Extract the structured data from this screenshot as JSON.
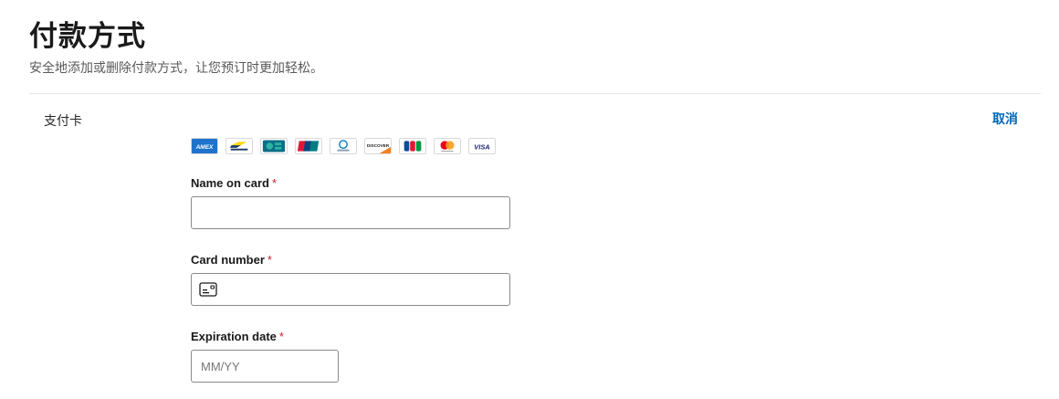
{
  "header": {
    "title": "付款方式",
    "subtitle": "安全地添加或删除付款方式，让您预订时更加轻松。"
  },
  "section": {
    "label": "支付卡",
    "cancel_label": "取消"
  },
  "card_brands": [
    {
      "name": "amex-icon",
      "label": "AMEX"
    },
    {
      "name": "bancontact-icon",
      "label": "Bancontact"
    },
    {
      "name": "cartes-bancaires-icon",
      "label": "CB"
    },
    {
      "name": "unionpay-icon",
      "label": "UnionPay"
    },
    {
      "name": "diners-club-icon",
      "label": "Diners Club"
    },
    {
      "name": "discover-icon",
      "label": "DISCOVER"
    },
    {
      "name": "jcb-icon",
      "label": "JCB"
    },
    {
      "name": "mastercard-icon",
      "label": "mastercard"
    },
    {
      "name": "visa-icon",
      "label": "VISA"
    }
  ],
  "form": {
    "name_label": "Name on card",
    "name_value": "",
    "card_label": "Card number",
    "card_value": "",
    "expiry_label": "Expiration date",
    "expiry_placeholder": "MM/YY",
    "required_mark": "*"
  },
  "colors": {
    "link": "#0067b8",
    "required": "#c4262e"
  }
}
